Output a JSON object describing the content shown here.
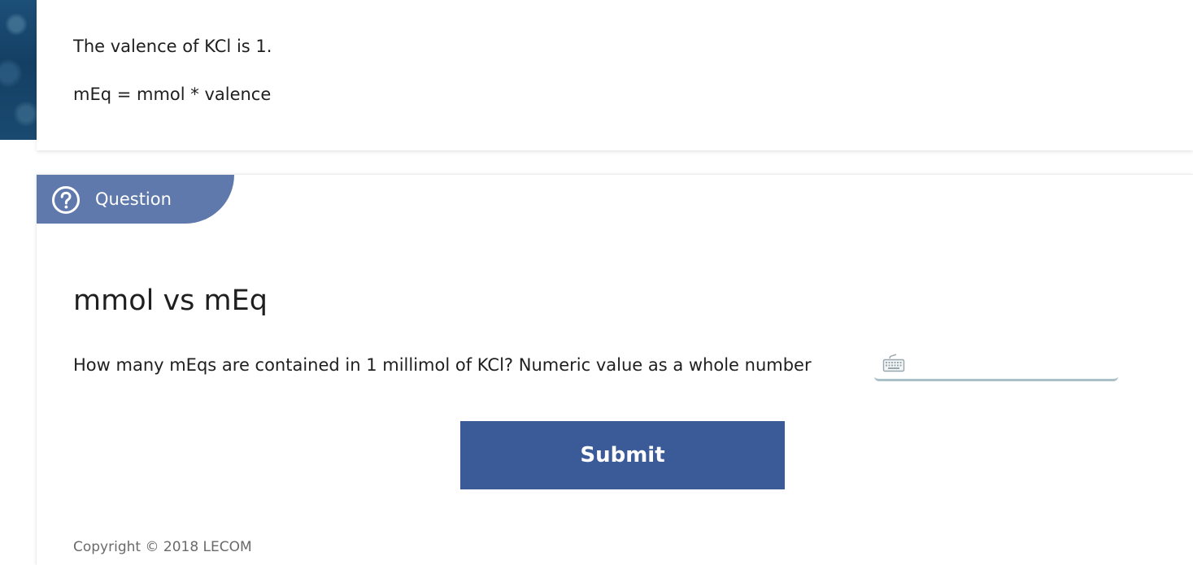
{
  "info": {
    "line_1": "The valence of KCl is 1.",
    "line_2": "mEq = mmol * valence"
  },
  "question_panel": {
    "tab_label": "Question",
    "title": "mmol vs mEq",
    "prompt": "How many mEqs are contained in 1 millimol of KCl? Numeric value as a whole number",
    "answer_value": "",
    "answer_placeholder": "",
    "submit_label": "Submit"
  },
  "footer": {
    "copyright": "Copyright © 2018 LECOM"
  },
  "colors": {
    "tab_background": "#6079ad",
    "submit_background": "#3a5a98",
    "input_underline": "#a9c0c8",
    "sidebar_image": "#1a4a70"
  },
  "icons": {
    "tab_icon": "help-circle-icon",
    "input_icon": "keyboard-icon"
  }
}
